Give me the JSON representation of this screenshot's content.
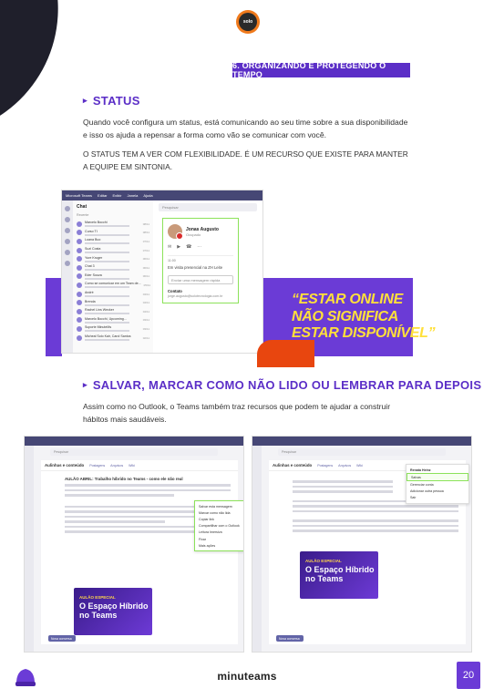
{
  "header": {
    "logo_text": "solo",
    "section_tag": "6. ORGANIZANDO E PROTEGENDO O TEMPO"
  },
  "status": {
    "heading": "STATUS",
    "paragraph": "Quando você configura um status, está comunicando ao seu time sobre a sua disponibilidade e isso os ajuda a repensar a forma como vão se comunicar com você.",
    "highlight": "O STATUS TEM A VER COM FLEXIBILIDADE. É UM RECURSO QUE EXISTE PARA MANTER A EQUIPE EM SINTONIA."
  },
  "teams_status_shot": {
    "app_title": "Microsoft Teams",
    "menu": [
      "Editar",
      "Exibir",
      "Janela",
      "Ajuda"
    ],
    "search_placeholder": "Pesquisar",
    "chat_title": "Chat",
    "section_recent": "Recente",
    "chats": [
      {
        "name": "Marcelo Bocchi",
        "time": "08/11"
      },
      {
        "name": "Curso TI",
        "time": "08/11"
      },
      {
        "name": "Luana Buo",
        "time": "07/11"
      },
      {
        "name": "Suzi Costa",
        "time": "07/11"
      },
      {
        "name": "Yure Kruger",
        "time": "06/11"
      },
      {
        "name": "Chat 3",
        "time": "06/11"
      },
      {
        "name": "Eder Souza",
        "time": "06/11"
      },
      {
        "name": "Como se comunicar em um Team de...",
        "time": "05/11"
      },
      {
        "name": "André",
        "time": "04/11"
      },
      {
        "name": "Brenda",
        "time": "04/11"
      },
      {
        "name": "Rachel Lins Wecker",
        "time": "04/11"
      },
      {
        "name": "Marcelo Bocchi, Upcoming...",
        "time": "03/11"
      },
      {
        "name": "Suporte MinuteMs",
        "time": "03/11"
      },
      {
        "name": "Micheal Solo Kair, Carol Santos",
        "time": "02/11"
      }
    ],
    "card": {
      "name": "Jonas Augusto",
      "status": "Ocupado",
      "time_label": "11:00",
      "schedule": "Em visita presencial na ZH Leite",
      "message_placeholder": "Enviar uma mensagem rápida",
      "contact_label": "Contato",
      "email": "jorge.augusto@solotecnologia.com.br"
    }
  },
  "quote": {
    "line1": "“ESTAR ONLINE",
    "line2": "NÃO SIGNIFICA",
    "line3": "ESTAR DISPONÍVEL”"
  },
  "salvar": {
    "heading": "SALVAR, MARCAR COMO NÃO LIDO OU LEMBRAR PARA DEPOIS",
    "paragraph": "Assim como no Outlook, o Teams também traz recursos que podem te ajudar a construir hábitos mais saudáveis."
  },
  "shot_left": {
    "search": "Pesquisar",
    "channel": "Aulinhas e conteúdo",
    "tabs": [
      "Postagens",
      "Arquivos",
      "Wiki"
    ],
    "post_title": "AULÃO ABRIL: Trabalho híbrido no Teams - como ele não real",
    "menu_items": [
      "Salvar esta mensagem",
      "Marcar como não lida",
      "Copiar link",
      "Compartilhar com o Outlook",
      "Leitura Imersiva",
      "Fixar",
      "Mais ações"
    ],
    "video_tag": "AULÃO ESPECIAL",
    "video_title": "O Espaço Híbrido no Teams",
    "new_button": "Nova conversa"
  },
  "shot_right": {
    "search": "Pesquisar",
    "channel": "Aulinhas e conteúdo",
    "tabs": [
      "Postagens",
      "Arquivos",
      "Wiki"
    ],
    "profile_name": "Renata Heinz",
    "menu_items": [
      "Salvas",
      "Gerenciar conta",
      "Adicionar outra pessoa",
      "Sair"
    ],
    "video_tag": "AULÃO ESPECIAL",
    "video_title": "O Espaço Híbrido no Teams",
    "new_button": "Nova conversa"
  },
  "footer": {
    "brand": "minuteams",
    "page_number": "20"
  },
  "colors": {
    "purple": "#6b3bd6",
    "yellow": "#ffe03a",
    "orange": "#e8460f",
    "highlight_green": "#8ce25a"
  }
}
